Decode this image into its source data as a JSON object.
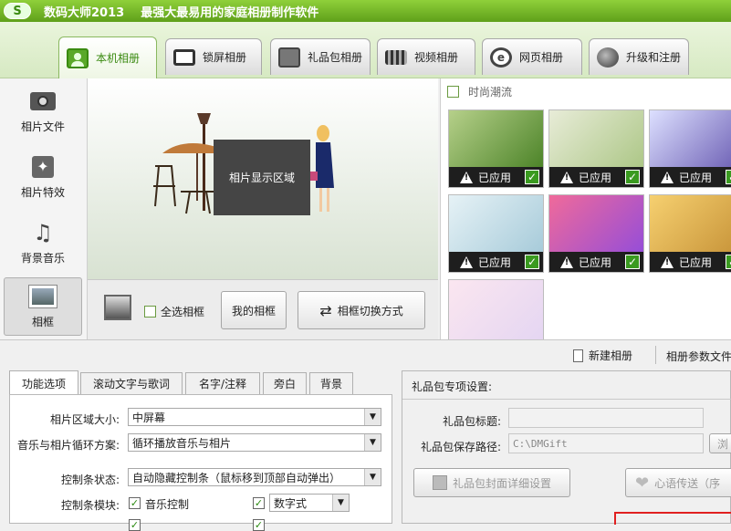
{
  "window": {
    "logo": "S",
    "app_title": "数码大师2013",
    "slogan": "最强大最易用的家庭相册制作软件"
  },
  "main_tabs": [
    {
      "label": "本机相册",
      "icon": "portrait-icon"
    },
    {
      "label": "锁屏相册",
      "icon": "monitor-icon"
    },
    {
      "label": "礼品包相册",
      "icon": "gift-icon"
    },
    {
      "label": "视频相册",
      "icon": "film-icon"
    },
    {
      "label": "网页相册",
      "icon": "ie-icon"
    },
    {
      "label": "升级和注册",
      "icon": "globe-icon"
    }
  ],
  "sidebar": [
    {
      "label": "相片文件",
      "icon": "camera-icon"
    },
    {
      "label": "相片特效",
      "icon": "sparkle-icon"
    },
    {
      "label": "背景音乐",
      "icon": "music-note-icon"
    },
    {
      "label": "相框",
      "icon": "picture-frame-icon"
    }
  ],
  "preview": {
    "display_label": "相片显示区域"
  },
  "frame_bar": {
    "select_all": "全选相框",
    "my_frames": "我的相框",
    "switch_mode": "相框切换方式"
  },
  "themes": {
    "category": "时尚潮流",
    "applied_label": "已应用",
    "thumbs": [
      {
        "colors": [
          "#b6d08a",
          "#3f7a1c"
        ],
        "applied": true
      },
      {
        "colors": [
          "#e8ecd8",
          "#a5c27c"
        ],
        "applied": true
      },
      {
        "colors": [
          "#dde0ff",
          "#5a4aa8"
        ],
        "applied": true
      },
      {
        "colors": [
          "#e6f2f6",
          "#9fc6d6"
        ],
        "applied": true
      },
      {
        "colors": [
          "#f06a9a",
          "#8a4ae0"
        ],
        "applied": true
      },
      {
        "colors": [
          "#f6d070",
          "#c08a30"
        ],
        "applied": true
      },
      {
        "colors": [
          "#fbe6f0",
          "#e2d4f2"
        ],
        "applied": false
      }
    ]
  },
  "midbar": {
    "new_album": "新建相册",
    "album_params": "相册参数文件"
  },
  "bottom_tabs": [
    "功能选项",
    "滚动文字与歌词",
    "名字/注释",
    "旁白",
    "背景"
  ],
  "options": {
    "area_size_label": "相片区域大小:",
    "area_size_value": "中屏幕",
    "loop_label": "音乐与相片循环方案:",
    "loop_value": "循环播放音乐与相片",
    "control_state_label": "控制条状态:",
    "control_state_value": "自动隐藏控制条（鼠标移到顶部自动弹出）",
    "control_module_label": "控制条模块:",
    "music_control": "音乐控制",
    "digital_label": "数字式"
  },
  "gift": {
    "heading": "礼品包专项设置:",
    "title_label": "礼品包标题:",
    "title_value": "",
    "path_label": "礼品包保存路径:",
    "path_value": "C:\\DMGift",
    "browse": "浏",
    "cover_btn": "礼品包封面详细设置",
    "heart_btn": "心语传送（序"
  }
}
